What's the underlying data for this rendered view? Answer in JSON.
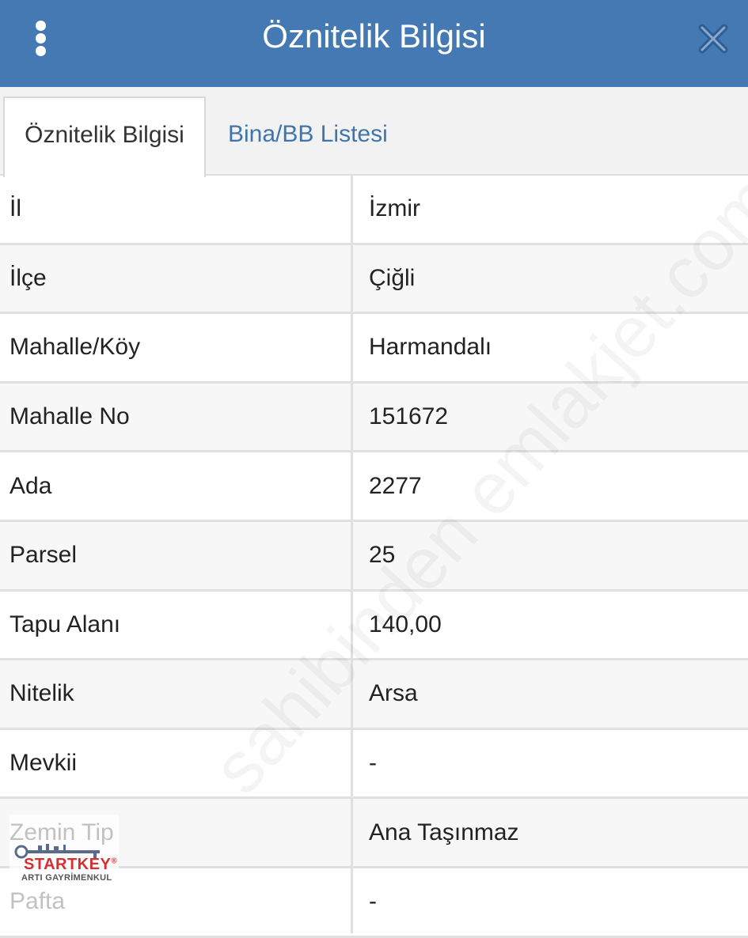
{
  "header": {
    "title": "Öznitelik Bilgisi",
    "menu_icon": "kebab-menu-icon",
    "close_icon": "close-icon"
  },
  "tabs": [
    {
      "label": "Öznitelik Bilgisi",
      "active": true
    },
    {
      "label": "Bina/BB Listesi",
      "active": false
    }
  ],
  "rows": [
    {
      "label": "İl",
      "value": "İzmir"
    },
    {
      "label": "İlçe",
      "value": "Çiğli"
    },
    {
      "label": "Mahalle/Köy",
      "value": "Harmandalı"
    },
    {
      "label": "Mahalle No",
      "value": "151672"
    },
    {
      "label": "Ada",
      "value": "2277"
    },
    {
      "label": "Parsel",
      "value": "25"
    },
    {
      "label": "Tapu Alanı",
      "value": "140,00"
    },
    {
      "label": "Nitelik",
      "value": "Arsa"
    },
    {
      "label": "Mevkii",
      "value": "-"
    },
    {
      "label": "Zemin Tip",
      "value": "Ana Taşınmaz"
    },
    {
      "label": "Pafta",
      "value": "-"
    }
  ],
  "watermark": "sahibinden emlakjet.com",
  "logo": {
    "name": "STARTKEY",
    "registered": "®",
    "subtitle": "ARTI GAYRİMENKUL"
  },
  "colors": {
    "header_bg": "#4579b3",
    "tab_link": "#3f75ab",
    "logo_red": "#d62f2f"
  }
}
